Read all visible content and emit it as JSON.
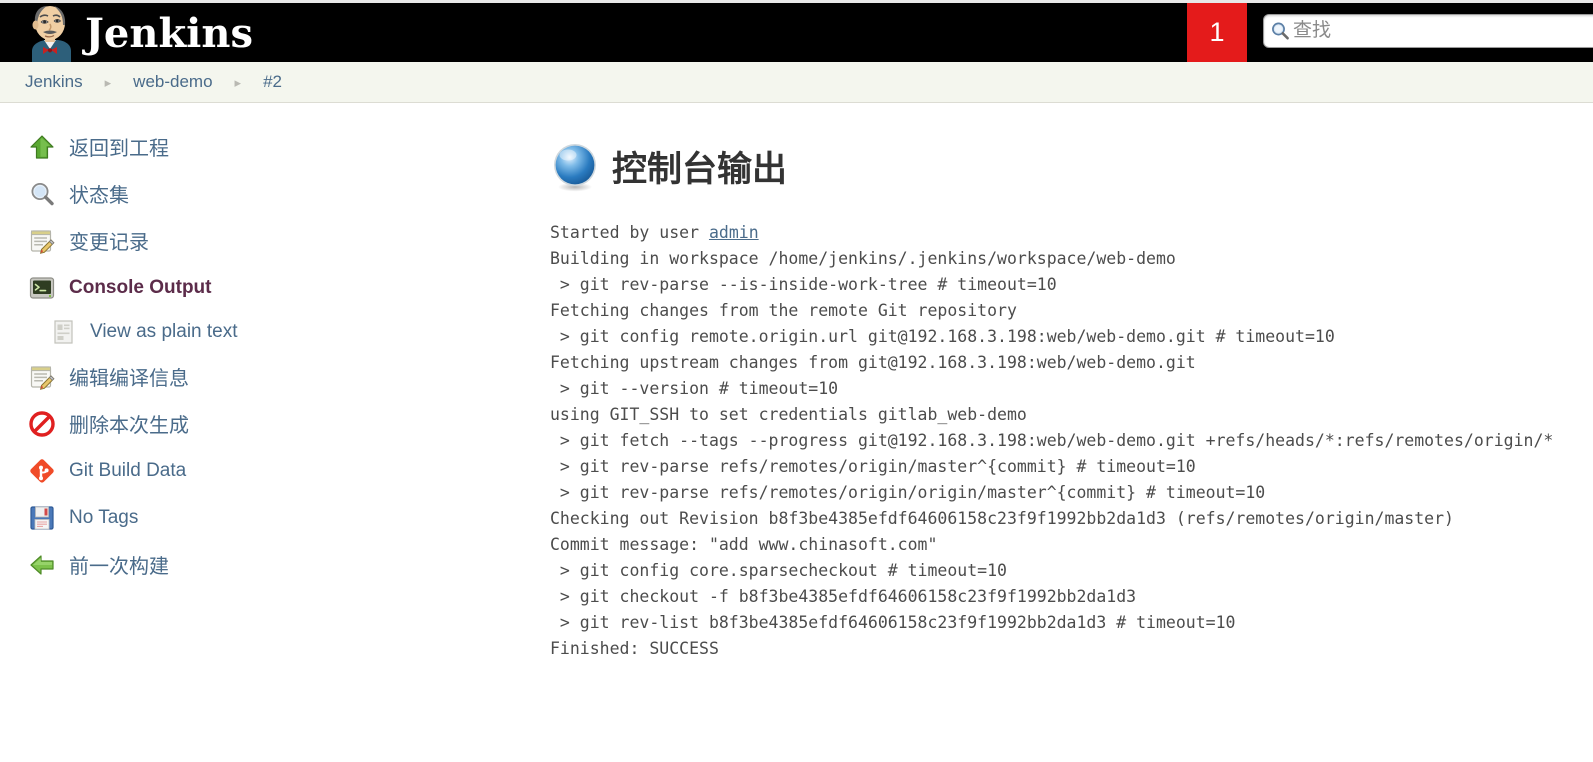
{
  "header": {
    "brand_text": "Jenkins",
    "logo_icon": "jenkins-butler-icon",
    "build_badge": "1",
    "search": {
      "icon": "search-icon",
      "placeholder": "查找",
      "value": ""
    }
  },
  "breadcrumb": {
    "separator": "▸",
    "items": [
      {
        "label": "Jenkins"
      },
      {
        "label": "web-demo"
      },
      {
        "label": "#2"
      }
    ]
  },
  "sidebar": {
    "items": [
      {
        "label": "返回到工程",
        "icon": "up-arrow-icon",
        "active": false,
        "sub": false
      },
      {
        "label": "状态集",
        "icon": "magnifier-icon",
        "active": false,
        "sub": false
      },
      {
        "label": "变更记录",
        "icon": "notepad-pencil-icon",
        "active": false,
        "sub": false
      },
      {
        "label": "Console Output",
        "icon": "terminal-icon",
        "active": true,
        "sub": false
      },
      {
        "label": "View as plain text",
        "icon": "document-icon",
        "active": false,
        "sub": true
      },
      {
        "label": "编辑编译信息",
        "icon": "notepad-pencil-icon",
        "active": false,
        "sub": false
      },
      {
        "label": "删除本次生成",
        "icon": "no-entry-icon",
        "active": false,
        "sub": false
      },
      {
        "label": "Git Build Data",
        "icon": "git-icon",
        "active": false,
        "sub": false
      },
      {
        "label": "No Tags",
        "icon": "floppy-disk-icon",
        "active": false,
        "sub": false
      },
      {
        "label": "前一次构建",
        "icon": "left-arrow-icon",
        "active": false,
        "sub": false
      }
    ]
  },
  "main": {
    "title": "控制台输出",
    "title_icon": "blue-ball-status-icon",
    "console": {
      "prefix": "Started by user ",
      "user_link": "admin",
      "lines": [
        "Building in workspace /home/jenkins/.jenkins/workspace/web-demo",
        " > git rev-parse --is-inside-work-tree # timeout=10",
        "Fetching changes from the remote Git repository",
        " > git config remote.origin.url git@192.168.3.198:web/web-demo.git # timeout=10",
        "Fetching upstream changes from git@192.168.3.198:web/web-demo.git",
        " > git --version # timeout=10",
        "using GIT_SSH to set credentials gitlab_web-demo",
        " > git fetch --tags --progress git@192.168.3.198:web/web-demo.git +refs/heads/*:refs/remotes/origin/*",
        " > git rev-parse refs/remotes/origin/master^{commit} # timeout=10",
        " > git rev-parse refs/remotes/origin/origin/master^{commit} # timeout=10",
        "Checking out Revision b8f3be4385efdf64606158c23f9f1992bb2da1d3 (refs/remotes/origin/master)",
        "Commit message: \"add www.chinasoft.com\"",
        " > git config core.sparsecheckout # timeout=10",
        " > git checkout -f b8f3be4385efdf64606158c23f9f1992bb2da1d3",
        " > git rev-list b8f3be4385efdf64606158c23f9f1992bb2da1d3 # timeout=10",
        "Finished: SUCCESS"
      ]
    }
  },
  "colors": {
    "header_bg": "#000000",
    "badge_red": "#e41b1b",
    "breadcrumb_bg": "#f4f6ee",
    "link_blue": "#4a6b8a",
    "active_purple": "#5c2c4a",
    "console_text": "#4c4c4c"
  }
}
